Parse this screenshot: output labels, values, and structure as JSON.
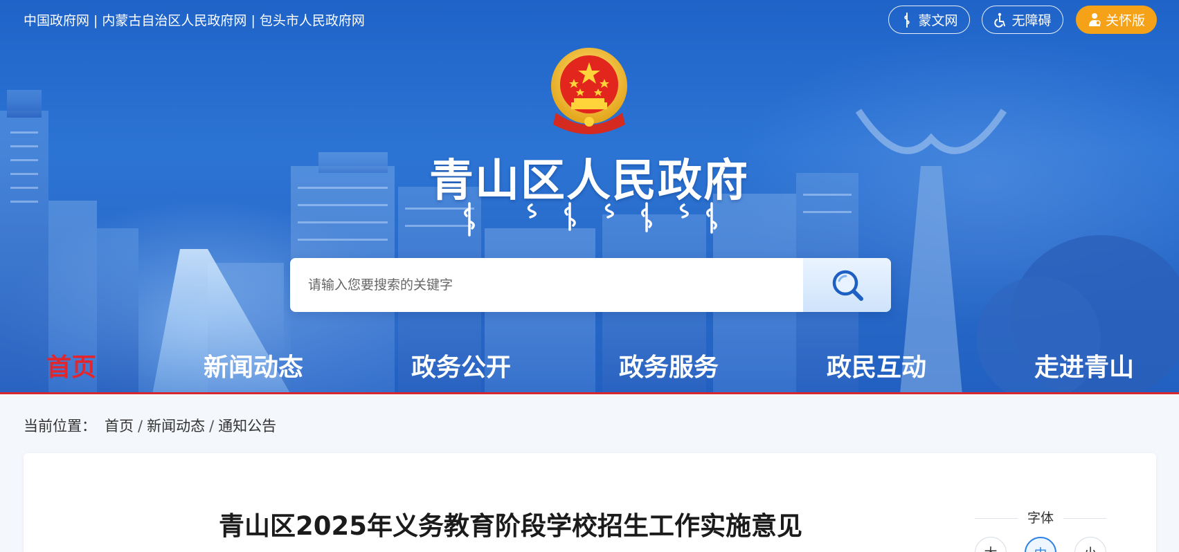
{
  "top_links": [
    {
      "label": "中国政府网"
    },
    {
      "label": "内蒙古自治区人民政府网"
    },
    {
      "label": "包头市人民政府网"
    }
  ],
  "top_link_separator": "|",
  "buttons": {
    "mongolian": "蒙文网",
    "accessibility": "无障碍",
    "care": "关怀版"
  },
  "site_title": "青山区人民政府",
  "search": {
    "placeholder": "请输入您要搜索的关键字"
  },
  "nav": [
    {
      "label": "首页",
      "active": true
    },
    {
      "label": "新闻动态",
      "active": false
    },
    {
      "label": "政务公开",
      "active": false
    },
    {
      "label": "政务服务",
      "active": false
    },
    {
      "label": "政民互动",
      "active": false
    },
    {
      "label": "走进青山",
      "active": false
    }
  ],
  "breadcrumb": {
    "lead": "当前位置：",
    "items": [
      "首页",
      "新闻动态",
      "通知公告"
    ],
    "separator": "/"
  },
  "article": {
    "title": "青山区2025年义务教育阶段学校招生工作实施意见"
  },
  "font_size": {
    "label": "字体",
    "options": [
      "大",
      "中",
      "小"
    ],
    "selected": "中"
  },
  "colors": {
    "banner_blue": "#2a6ccb",
    "active_nav_red": "#e1262e",
    "care_orange": "#f5a219",
    "accent_blue": "#2e82e6"
  }
}
